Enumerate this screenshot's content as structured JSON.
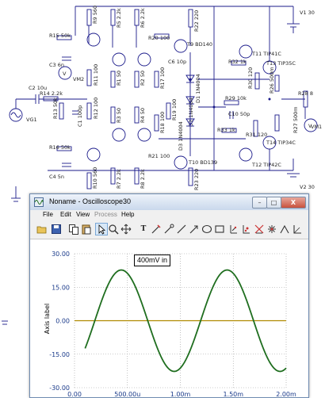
{
  "schematic": {
    "components": {
      "r9": "R9 560",
      "r5": "R5 2.2k",
      "r6": "R6 2.2k",
      "r22": "R22 220",
      "v1": "V1 30",
      "r15": "R15 50k",
      "r20": "R20 100",
      "t9": "T9 BD140",
      "c3": "C3 6n",
      "vm2": "VM2",
      "r11": "R11 100",
      "r1": "R1 50",
      "r2": "R2 50",
      "r17": "R17 100",
      "c6": "C6 10p",
      "t11": "T11 TIP41C",
      "t13": "T13 TIP35C",
      "r32": "R32 1k",
      "r30": "R30 120",
      "r26": "R26 500m",
      "r28": "R28 8",
      "c2": "C2 10u",
      "r14": "R14 2.2k",
      "r13": "R13 50k",
      "c1": "C1 100p",
      "vg1": "VG1",
      "r12": "R12 100",
      "d1": "D1 1N4004",
      "d2": "D2 1N4004",
      "d3": "D3 1N4004",
      "r29": "R29 10k",
      "c10": "C10 50p",
      "r3": "R3 50",
      "r4": "R4 50",
      "r19": "R19 100",
      "r18": "R18 100",
      "r27": "R27 500m",
      "vm1": "VM1",
      "r33": "R33 1k",
      "r31": "R31 120",
      "r16": "R16 50k",
      "c4": "C4 5n",
      "r21": "R21 100",
      "t10": "T10 BD139",
      "t12": "T12 TIP42C",
      "t14": "T14 TIP34C",
      "r10": "R10 560",
      "r7": "R7 2.2k",
      "r8": "R8 2.2k",
      "r23": "R23 220",
      "v2": "V2 30"
    }
  },
  "scope": {
    "title": "Noname - Oscilloscope30",
    "window_buttons": {
      "minimize": "–",
      "maximize": "□",
      "close": "X"
    },
    "menu": [
      "File",
      "Edit",
      "View",
      "Process",
      "Help"
    ],
    "menu_disabled": [
      "Process"
    ],
    "toolbar_icons": [
      "open-folder-icon",
      "save-icon",
      "copy-icon",
      "paste-icon",
      "pointer-icon",
      "zoom-icon",
      "pan-icon",
      "text-icon",
      "probe-icon",
      "cursor-icon",
      "line-icon",
      "arrow-icon",
      "ellipse-icon",
      "rectangle-icon",
      "bracket-icon",
      "marker-icon",
      "cross-icon",
      "star-icon",
      "angle-icon",
      "corner-icon"
    ],
    "annotation": "400mV in",
    "ylabel": "Axis label",
    "colors": {
      "trace": "#1f6e1f",
      "baseline": "#b08a00",
      "axis_text": "#1a3a8a"
    }
  },
  "chart_data": {
    "type": "line",
    "title": "",
    "xlabel": "",
    "ylabel": "Axis label",
    "x_ticks": [
      "0.00",
      "500.00u",
      "1.00m",
      "1.50m",
      "2.00m"
    ],
    "x_tick_values": [
      0,
      0.0005,
      0.001,
      0.0015,
      0.002
    ],
    "y_ticks": [
      "30.00",
      "15.00",
      "0.00",
      "-15.00",
      "-30.00"
    ],
    "y_tick_values": [
      30,
      15,
      0,
      -15,
      -30
    ],
    "xlim": [
      0,
      0.002
    ],
    "ylim": [
      -30,
      30
    ],
    "grid": true,
    "series": [
      {
        "amplitude": 22.7,
        "frequency": 1000,
        "start_x": 0.0001,
        "start_y": -12.4,
        "end_y": -20.5,
        "samples": [
          [
            0.0001,
            -12.4
          ],
          [
            0.00015,
            -3.0
          ],
          [
            0.0002,
            7.0
          ],
          [
            0.00025,
            15.5
          ],
          [
            0.0003,
            21.0
          ],
          [
            0.00035,
            22.7
          ],
          [
            0.0004,
            21.0
          ],
          [
            0.00045,
            15.5
          ],
          [
            0.0005,
            7.0
          ],
          [
            0.00055,
            -3.0
          ],
          [
            0.0006,
            -12.4
          ],
          [
            0.00065,
            -19.5
          ],
          [
            0.0007,
            -22.7
          ],
          [
            0.00075,
            -21.0
          ],
          [
            0.0008,
            -15.5
          ],
          [
            0.00085,
            -7.0
          ],
          [
            0.0009,
            3.0
          ],
          [
            0.00095,
            12.4
          ],
          [
            0.001,
            19.5
          ],
          [
            0.00105,
            22.7
          ],
          [
            0.0011,
            21.0
          ],
          [
            0.00115,
            15.5
          ],
          [
            0.0012,
            7.0
          ],
          [
            0.00125,
            -3.0
          ],
          [
            0.0013,
            -12.4
          ],
          [
            0.00135,
            -19.5
          ],
          [
            0.0014,
            -22.7
          ],
          [
            0.00145,
            -21.0
          ],
          [
            0.0015,
            -15.5
          ],
          [
            0.00155,
            -7.0
          ],
          [
            0.0016,
            3.0
          ],
          [
            0.00165,
            12.4
          ],
          [
            0.0017,
            19.5
          ],
          [
            0.00175,
            22.7
          ],
          [
            0.0018,
            21.0
          ],
          [
            0.00185,
            15.5
          ],
          [
            0.0019,
            7.0
          ],
          [
            0.00195,
            -3.0
          ],
          [
            0.002,
            -12.4
          ]
        ]
      },
      {
        "constant": 0
      }
    ]
  }
}
